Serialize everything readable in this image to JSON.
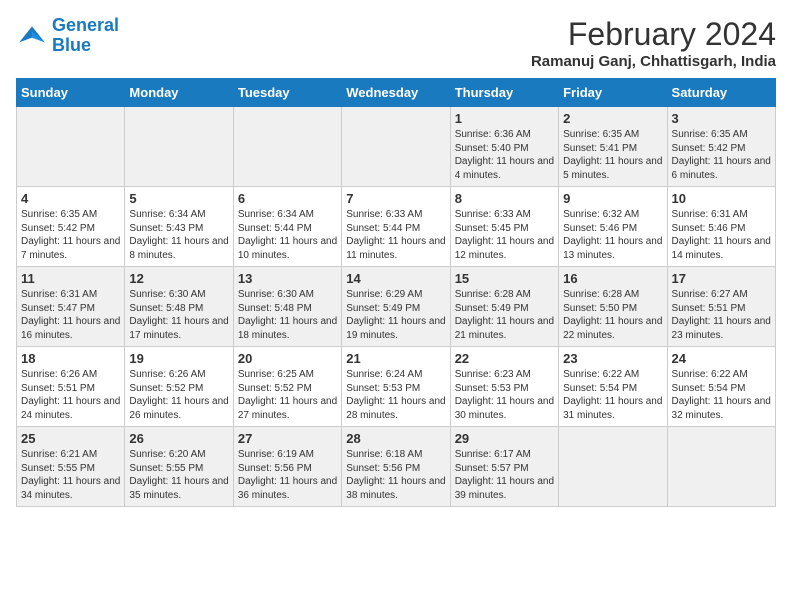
{
  "logo": {
    "line1": "General",
    "line2": "Blue"
  },
  "title": "February 2024",
  "location": "Ramanuj Ganj, Chhattisgarh, India",
  "days_of_week": [
    "Sunday",
    "Monday",
    "Tuesday",
    "Wednesday",
    "Thursday",
    "Friday",
    "Saturday"
  ],
  "weeks": [
    [
      {
        "day": "",
        "info": ""
      },
      {
        "day": "",
        "info": ""
      },
      {
        "day": "",
        "info": ""
      },
      {
        "day": "",
        "info": ""
      },
      {
        "day": "1",
        "info": "Sunrise: 6:36 AM\nSunset: 5:40 PM\nDaylight: 11 hours and 4 minutes."
      },
      {
        "day": "2",
        "info": "Sunrise: 6:35 AM\nSunset: 5:41 PM\nDaylight: 11 hours and 5 minutes."
      },
      {
        "day": "3",
        "info": "Sunrise: 6:35 AM\nSunset: 5:42 PM\nDaylight: 11 hours and 6 minutes."
      }
    ],
    [
      {
        "day": "4",
        "info": "Sunrise: 6:35 AM\nSunset: 5:42 PM\nDaylight: 11 hours and 7 minutes."
      },
      {
        "day": "5",
        "info": "Sunrise: 6:34 AM\nSunset: 5:43 PM\nDaylight: 11 hours and 8 minutes."
      },
      {
        "day": "6",
        "info": "Sunrise: 6:34 AM\nSunset: 5:44 PM\nDaylight: 11 hours and 10 minutes."
      },
      {
        "day": "7",
        "info": "Sunrise: 6:33 AM\nSunset: 5:44 PM\nDaylight: 11 hours and 11 minutes."
      },
      {
        "day": "8",
        "info": "Sunrise: 6:33 AM\nSunset: 5:45 PM\nDaylight: 11 hours and 12 minutes."
      },
      {
        "day": "9",
        "info": "Sunrise: 6:32 AM\nSunset: 5:46 PM\nDaylight: 11 hours and 13 minutes."
      },
      {
        "day": "10",
        "info": "Sunrise: 6:31 AM\nSunset: 5:46 PM\nDaylight: 11 hours and 14 minutes."
      }
    ],
    [
      {
        "day": "11",
        "info": "Sunrise: 6:31 AM\nSunset: 5:47 PM\nDaylight: 11 hours and 16 minutes."
      },
      {
        "day": "12",
        "info": "Sunrise: 6:30 AM\nSunset: 5:48 PM\nDaylight: 11 hours and 17 minutes."
      },
      {
        "day": "13",
        "info": "Sunrise: 6:30 AM\nSunset: 5:48 PM\nDaylight: 11 hours and 18 minutes."
      },
      {
        "day": "14",
        "info": "Sunrise: 6:29 AM\nSunset: 5:49 PM\nDaylight: 11 hours and 19 minutes."
      },
      {
        "day": "15",
        "info": "Sunrise: 6:28 AM\nSunset: 5:49 PM\nDaylight: 11 hours and 21 minutes."
      },
      {
        "day": "16",
        "info": "Sunrise: 6:28 AM\nSunset: 5:50 PM\nDaylight: 11 hours and 22 minutes."
      },
      {
        "day": "17",
        "info": "Sunrise: 6:27 AM\nSunset: 5:51 PM\nDaylight: 11 hours and 23 minutes."
      }
    ],
    [
      {
        "day": "18",
        "info": "Sunrise: 6:26 AM\nSunset: 5:51 PM\nDaylight: 11 hours and 24 minutes."
      },
      {
        "day": "19",
        "info": "Sunrise: 6:26 AM\nSunset: 5:52 PM\nDaylight: 11 hours and 26 minutes."
      },
      {
        "day": "20",
        "info": "Sunrise: 6:25 AM\nSunset: 5:52 PM\nDaylight: 11 hours and 27 minutes."
      },
      {
        "day": "21",
        "info": "Sunrise: 6:24 AM\nSunset: 5:53 PM\nDaylight: 11 hours and 28 minutes."
      },
      {
        "day": "22",
        "info": "Sunrise: 6:23 AM\nSunset: 5:53 PM\nDaylight: 11 hours and 30 minutes."
      },
      {
        "day": "23",
        "info": "Sunrise: 6:22 AM\nSunset: 5:54 PM\nDaylight: 11 hours and 31 minutes."
      },
      {
        "day": "24",
        "info": "Sunrise: 6:22 AM\nSunset: 5:54 PM\nDaylight: 11 hours and 32 minutes."
      }
    ],
    [
      {
        "day": "25",
        "info": "Sunrise: 6:21 AM\nSunset: 5:55 PM\nDaylight: 11 hours and 34 minutes."
      },
      {
        "day": "26",
        "info": "Sunrise: 6:20 AM\nSunset: 5:55 PM\nDaylight: 11 hours and 35 minutes."
      },
      {
        "day": "27",
        "info": "Sunrise: 6:19 AM\nSunset: 5:56 PM\nDaylight: 11 hours and 36 minutes."
      },
      {
        "day": "28",
        "info": "Sunrise: 6:18 AM\nSunset: 5:56 PM\nDaylight: 11 hours and 38 minutes."
      },
      {
        "day": "29",
        "info": "Sunrise: 6:17 AM\nSunset: 5:57 PM\nDaylight: 11 hours and 39 minutes."
      },
      {
        "day": "",
        "info": ""
      },
      {
        "day": "",
        "info": ""
      }
    ]
  ]
}
